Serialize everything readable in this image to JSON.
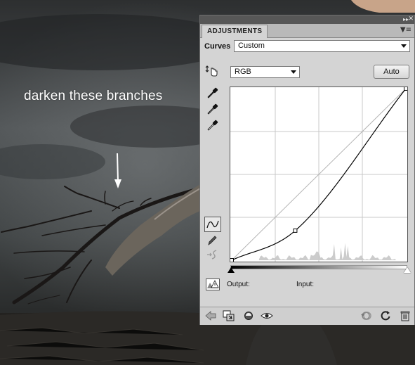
{
  "annotation": {
    "text": "darken these branches"
  },
  "panel": {
    "tab_label": "ADJUSTMENTS",
    "collapse_icon": "double-chevron-right-icon",
    "close_icon": "close-icon",
    "menu_icon": "panel-menu-icon",
    "adjustment_name": "Curves",
    "preset_value": "Custom",
    "channel_value": "RGB",
    "auto_label": "Auto",
    "output_label": "Output:",
    "input_label": "Input:"
  },
  "tools": [
    "on-image-adjust-icon",
    "black-point-eyedropper-icon",
    "gray-point-eyedropper-icon",
    "white-point-eyedropper-icon",
    "curve-edit-icon",
    "pencil-draw-icon",
    "smooth-curve-icon"
  ],
  "bottom_icons": [
    "back-arrow-icon",
    "clip-to-layer-icon",
    "visibility-state-icon",
    "eye-icon",
    "previous-state-icon",
    "reset-icon",
    "trash-icon"
  ],
  "curve": {
    "input_range": [
      0,
      255
    ],
    "points": [
      [
        0,
        0
      ],
      [
        93,
        44
      ],
      [
        255,
        255
      ]
    ],
    "grid_divisions": 4
  },
  "colors": {
    "panel_bg": "#d4d4d4",
    "panel_top": "#575757",
    "curve": "#000000",
    "baseline": "#b4b4b4",
    "histogram": "#cccccc"
  }
}
